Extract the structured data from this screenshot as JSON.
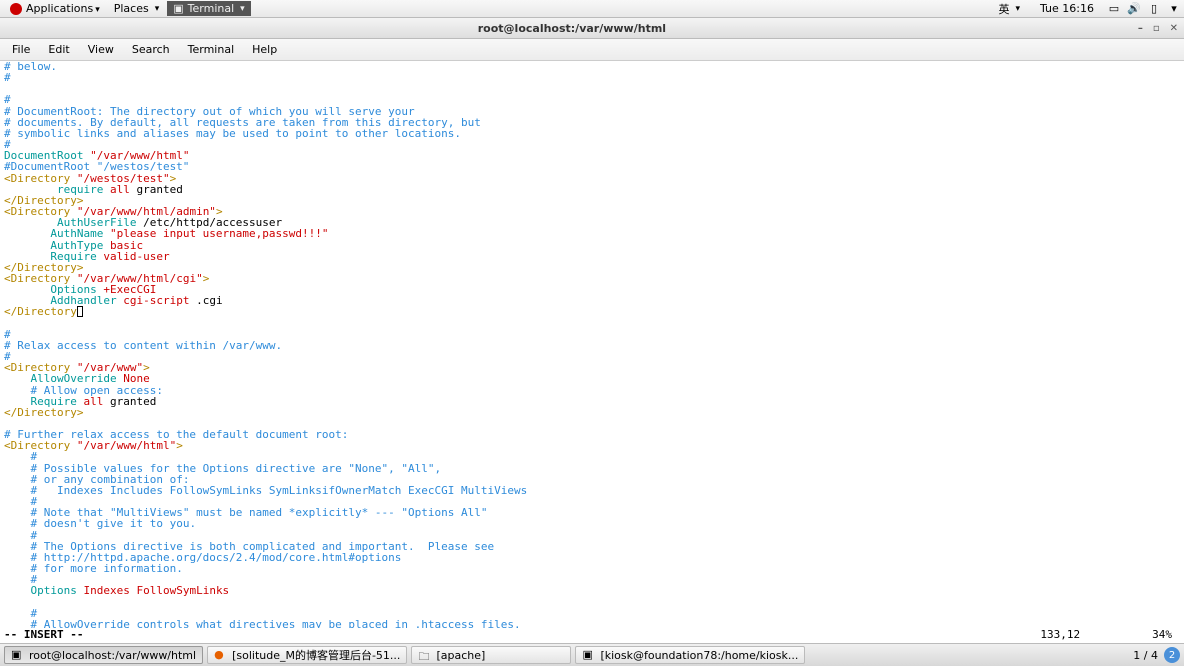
{
  "top_panel": {
    "apps": "Applications",
    "places": "Places",
    "current": "Terminal",
    "ime": "英",
    "clock": "Tue 16:16"
  },
  "window": {
    "title": "root@localhost:/var/www/html"
  },
  "menu": {
    "file": "File",
    "edit": "Edit",
    "view": "View",
    "search": "Search",
    "terminal": "Terminal",
    "help": "Help"
  },
  "status": {
    "mode": "-- INSERT --",
    "position": "133,12",
    "percent": "34%"
  },
  "taskbar": {
    "t1": "root@localhost:/var/www/html",
    "t2": "[solitude_M的博客管理后台-51...",
    "t3": "[apache]",
    "t4": "[kiosk@foundation78:/home/kiosk...",
    "ws_text": "1 / 4",
    "ws_badge": "2"
  },
  "code": {
    "below": "# below.",
    "hash": "#",
    "doc1": "# DocumentRoot: The directory out of which you will serve your",
    "doc2": "# documents. By default, all requests are taken from this directory, but",
    "doc3": "# symbolic links and aliases may be used to point to other locations.",
    "documentroot_kw": "DocumentRoot",
    "documentroot_val": "\"/var/www/html\"",
    "docroot_comment": "#DocumentRoot \"/westos/test\"",
    "dir_open": "<Directory",
    "dir_close_tag": ">",
    "westos_test": "\"/westos/test\"",
    "require": "require",
    "all": "all",
    "granted": " granted",
    "dir_close": "</Directory>",
    "admin_path": "\"/var/www/html/admin\"",
    "authuserfile": "AuthUserFile",
    "authuserfile_val": " /etc/httpd/accessuser",
    "authname": "AuthName",
    "authname_val": "\"please input username,passwd!!!\"",
    "authtype": "AuthType",
    "basic": "basic",
    "require2": "Require",
    "validuser": "valid-user",
    "cgi_path": "\"/var/www/html/cgi\"",
    "options": "Options",
    "execcgi": "+ExecCGI",
    "addhandler": "Addhandler",
    "cgiscript": "cgi",
    "cgiscript2": "script",
    "cgi_ext": " .cgi",
    "dir_close_cursor": "</Directory",
    "relax": "# Relax access to content within /var/www.",
    "varwww": "\"/var/www\"",
    "allowoverride": "AllowOverride",
    "none": "None",
    "allow_open": "# Allow open access:",
    "further": "# Further relax access to the default document root:",
    "htmlpath": "\"/var/www/html\"",
    "poss1": "# Possible values for the Options directive are \"None\", \"All\",",
    "poss2": "# or any combination of:",
    "poss3": "#   Indexes Includes FollowSymLinks SymLinksifOwnerMatch ExecCGI MultiViews",
    "note1": "# Note that \"MultiViews\" must be named *explicitly* --- \"Options All\"",
    "note2": "# doesn't give it to you.",
    "opt1": "# The Options directive is both complicated and important.  Please see",
    "opt2": "# http://httpd.apache.org/docs/2.4/mod/core.html#options",
    "opt3": "# for more information.",
    "indexes": "Indexes",
    "followsym": "FollowSymLinks",
    "ao_comment": "# AllowOverride controls what directives may be placed in .htaccess files.",
    "dash": "-"
  }
}
